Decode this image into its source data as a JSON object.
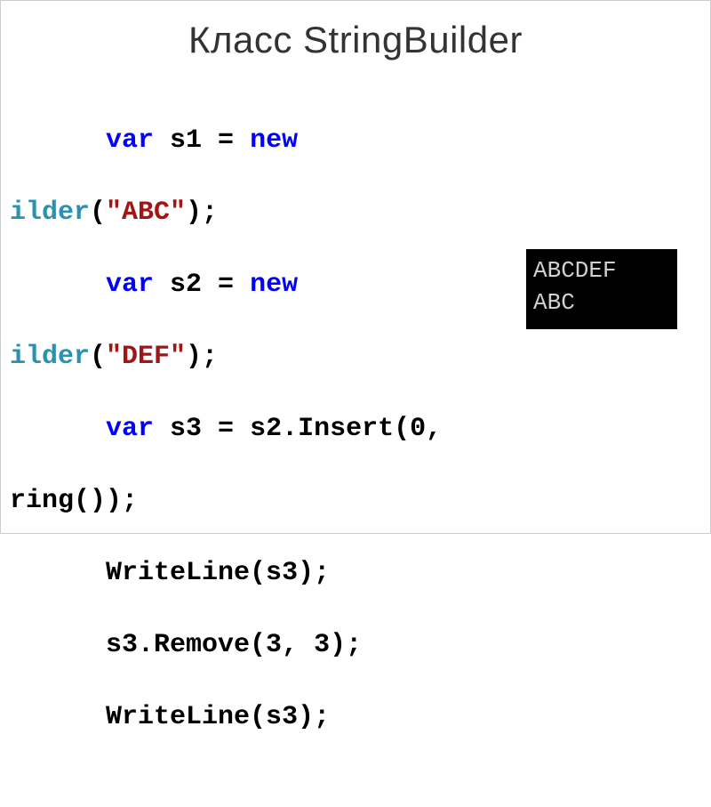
{
  "title": "Класс StringBuilder",
  "code": {
    "line1": {
      "indent": "      ",
      "kw1": "var",
      "mid": " s1 = ",
      "kw2": "new"
    },
    "line2": {
      "prefix": "ilder",
      "paren1": "(",
      "str": "\"ABC\"",
      "paren2": ");"
    },
    "line3": {
      "indent": "      ",
      "kw1": "var",
      "mid": " s2 = ",
      "kw2": "new"
    },
    "line4": {
      "prefix": "ilder",
      "paren1": "(",
      "str": "\"DEF\"",
      "paren2": ");"
    },
    "line5": {
      "indent": "      ",
      "kw1": "var",
      "mid": " s3 = s2.Insert(0,"
    },
    "line6": {
      "text": "ring());"
    },
    "line7": {
      "indent": "      ",
      "text": "WriteLine(s3);"
    },
    "line8": {
      "indent": "      ",
      "text": "s3.Remove(3, 3);"
    },
    "line9": {
      "indent": "      ",
      "text": "WriteLine(s3);"
    }
  },
  "output": {
    "line1": "ABCDEF",
    "line2": "ABC"
  }
}
